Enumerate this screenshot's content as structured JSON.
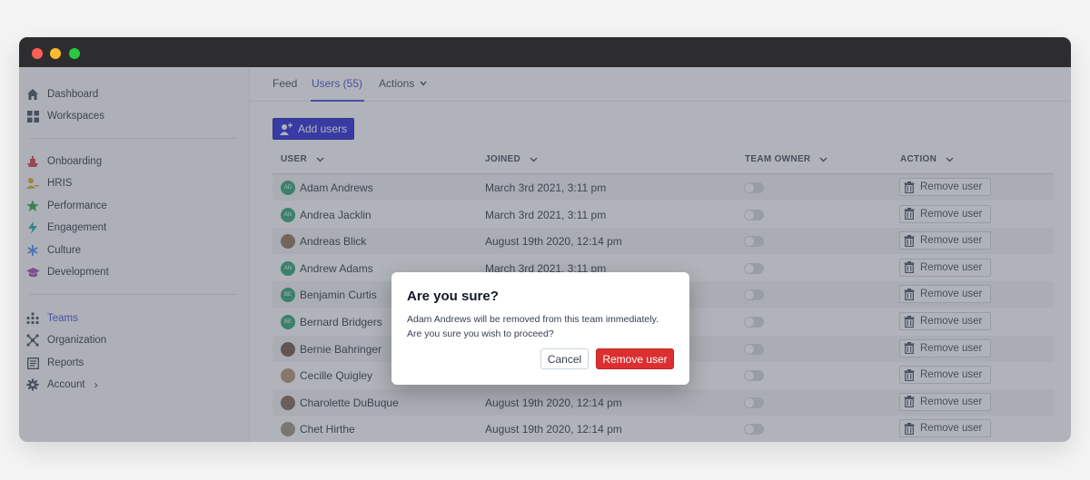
{
  "sidebar": {
    "top_items": [
      {
        "label": "Dashboard",
        "icon": "home-icon"
      },
      {
        "label": "Workspaces",
        "icon": "grid-icon"
      }
    ],
    "mid_items": [
      {
        "label": "Onboarding",
        "icon": "ship-icon"
      },
      {
        "label": "HRIS",
        "icon": "user-key-icon"
      },
      {
        "label": "Performance",
        "icon": "star-icon"
      },
      {
        "label": "Engagement",
        "icon": "bolt-icon"
      },
      {
        "label": "Culture",
        "icon": "asterisk-icon"
      },
      {
        "label": "Development",
        "icon": "graduation-cap-icon"
      }
    ],
    "bottom_items": [
      {
        "label": "Teams",
        "icon": "teams-icon"
      },
      {
        "label": "Organization",
        "icon": "organization-icon"
      },
      {
        "label": "Reports",
        "icon": "reports-icon"
      },
      {
        "label": "Account",
        "icon": "gear-icon"
      }
    ]
  },
  "tabs": {
    "feed": "Feed",
    "users": "Users (55)",
    "actions": "Actions"
  },
  "toolbar": {
    "add_users": "Add users"
  },
  "table": {
    "headers": {
      "user": "USER",
      "joined": "JOINED",
      "team_owner": "TEAM OWNER",
      "action": "ACTION"
    },
    "remove_label": "Remove user",
    "rows": [
      {
        "name": "Adam Andrews",
        "initials": "AD",
        "joined": "March 3rd 2021, 3:11 pm"
      },
      {
        "name": "Andrea Jacklin",
        "initials": "AN",
        "joined": "March 3rd 2021, 3:11 pm"
      },
      {
        "name": "Andreas Blick",
        "initials": "",
        "joined": "August 19th 2020, 12:14 pm"
      },
      {
        "name": "Andrew Adams",
        "initials": "AN",
        "joined": "March 3rd 2021, 3:11 pm"
      },
      {
        "name": "Benjamin Curtis",
        "initials": "BE",
        "joined": ""
      },
      {
        "name": "Bernard Bridgers",
        "initials": "BE",
        "joined": ""
      },
      {
        "name": "Bernie Bahringer",
        "initials": "",
        "joined": ""
      },
      {
        "name": "Cecille Quigley",
        "initials": "",
        "joined": ""
      },
      {
        "name": "Charolette DuBuque",
        "initials": "",
        "joined": "August 19th 2020, 12:14 pm"
      },
      {
        "name": "Chet Hirthe",
        "initials": "",
        "joined": "August 19th 2020, 12:14 pm"
      }
    ]
  },
  "modal": {
    "title": "Are you sure?",
    "message": "Adam Andrews will be removed from this team immediately. Are you sure you wish to proceed?",
    "cancel": "Cancel",
    "confirm": "Remove user"
  },
  "colors": {
    "accent": "#3b3fd8",
    "primary_button": "#1a1ad6",
    "danger": "#dc2f2f",
    "initials_avatar": "#22a06b"
  }
}
